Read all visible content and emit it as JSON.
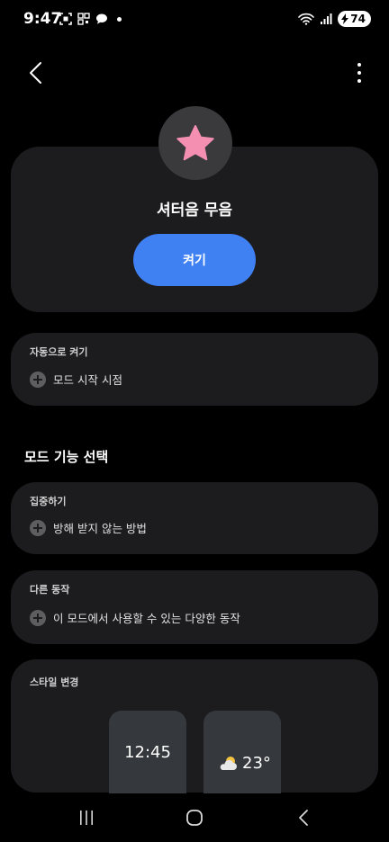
{
  "status_bar": {
    "time": "9:47",
    "battery": "74",
    "icons": [
      "screen-record-icon",
      "qr-icon",
      "chat-bubble-icon",
      "dot-icon",
      "wifi-icon",
      "signal-icon",
      "battery-charging-icon"
    ]
  },
  "top_bar": {
    "back_icon": "chevron-left-icon",
    "more_icon": "more-vertical-icon"
  },
  "mode": {
    "icon": "star-icon",
    "icon_color": "#f48fb1",
    "title": "셔터음 무음",
    "turn_on_label": "켜기",
    "accent": "#3f80f2"
  },
  "auto_on": {
    "label": "자동으로 켜기",
    "action": "모드 시작 시점"
  },
  "section_title": "모드 기능 선택",
  "focus": {
    "label": "집중하기",
    "action": "방해 받지 않는 방법"
  },
  "other_actions": {
    "label": "다른 동작",
    "action": "이 모드에서 사용할 수 있는 다양한 동작"
  },
  "style": {
    "label": "스타일 변경",
    "preview_clock": "12:45",
    "preview_temp": "23°"
  },
  "nav": {
    "recents_icon": "recents-icon",
    "home_icon": "home-icon",
    "back_icon": "back-icon"
  }
}
